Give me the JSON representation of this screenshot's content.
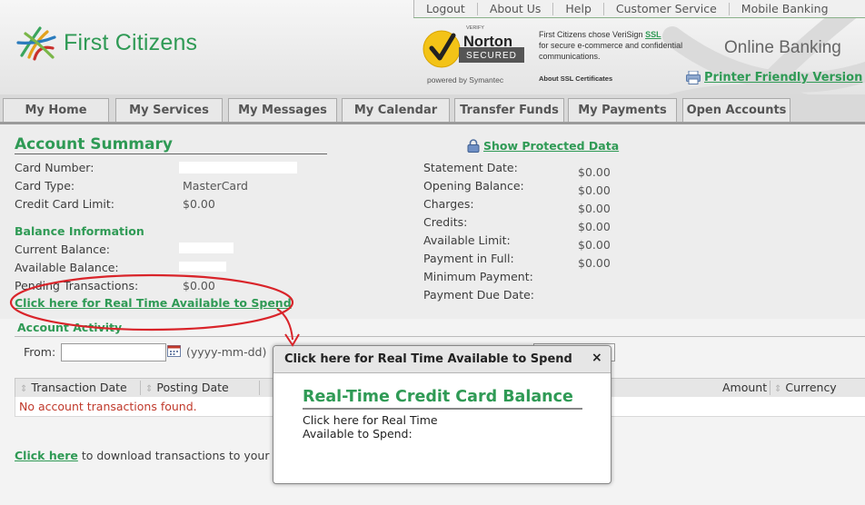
{
  "top_nav": [
    "Logout",
    "About Us",
    "Help",
    "Customer Service",
    "Mobile Banking"
  ],
  "brand": {
    "name": "First Citizens",
    "tagline": "Online Banking"
  },
  "norton": {
    "verify": "VERIFY",
    "name": "Norton",
    "secured": "SECURED",
    "powered": "powered by Symantec",
    "verisign_text": "First Citizens chose VeriSign",
    "verisign_link": "SSL",
    "verisign_rest": "for secure e-commerce and confidential communications.",
    "ssl_cert": "About SSL Certificates"
  },
  "printer_link": "Printer Friendly Version",
  "tabs": [
    "My Home",
    "My Services",
    "My Messages",
    "My Calendar",
    "Transfer Funds",
    "My Payments",
    "Open Accounts"
  ],
  "summary": {
    "title": "Account Summary",
    "show_protected": "Show Protected Data",
    "left": [
      {
        "label": "Card Number:",
        "value": ""
      },
      {
        "label": "Card Type:",
        "value": "MasterCard"
      },
      {
        "label": "Credit Card Limit:",
        "value": "$0.00"
      }
    ],
    "balance_title": "Balance Information",
    "balance": [
      {
        "label": "Current Balance:",
        "value": ""
      },
      {
        "label": "Available Balance:",
        "value": ""
      },
      {
        "label": "Pending Transactions:",
        "value": "$0.00"
      }
    ],
    "realtime_link": "Click here for Real Time Available to Spend",
    "right": [
      {
        "label": "Statement Date:",
        "value": "$0.00"
      },
      {
        "label": "Opening Balance:",
        "value": "$0.00"
      },
      {
        "label": "Charges:",
        "value": "$0.00"
      },
      {
        "label": "Credits:",
        "value": "$0.00"
      },
      {
        "label": "Available Limit:",
        "value": "$0.00"
      },
      {
        "label": "Payment in Full:",
        "value": "$0.00"
      },
      {
        "label": "Minimum Payment:",
        "value": ""
      },
      {
        "label": "Payment Due Date:",
        "value": ""
      }
    ]
  },
  "activity": {
    "title": "Account Activity",
    "from_label": "From:",
    "date_format": "(yyyy-mm-dd)",
    "columns": [
      "Transaction Date",
      "Posting Date",
      "Amount",
      "Currency"
    ],
    "empty_message": "No account transactions found.",
    "download_link": "Click here",
    "download_text": "to download transactions to your Ex"
  },
  "popup": {
    "title": "Click here for Real Time Available to Spend",
    "close": "×",
    "heading": "Real-Time Credit Card Balance",
    "body": "Click here for Real Time Available to Spend:"
  },
  "colors": {
    "brand_green": "#2f9a55",
    "annotation_red": "#d9242a",
    "error_red": "#c0392b"
  }
}
